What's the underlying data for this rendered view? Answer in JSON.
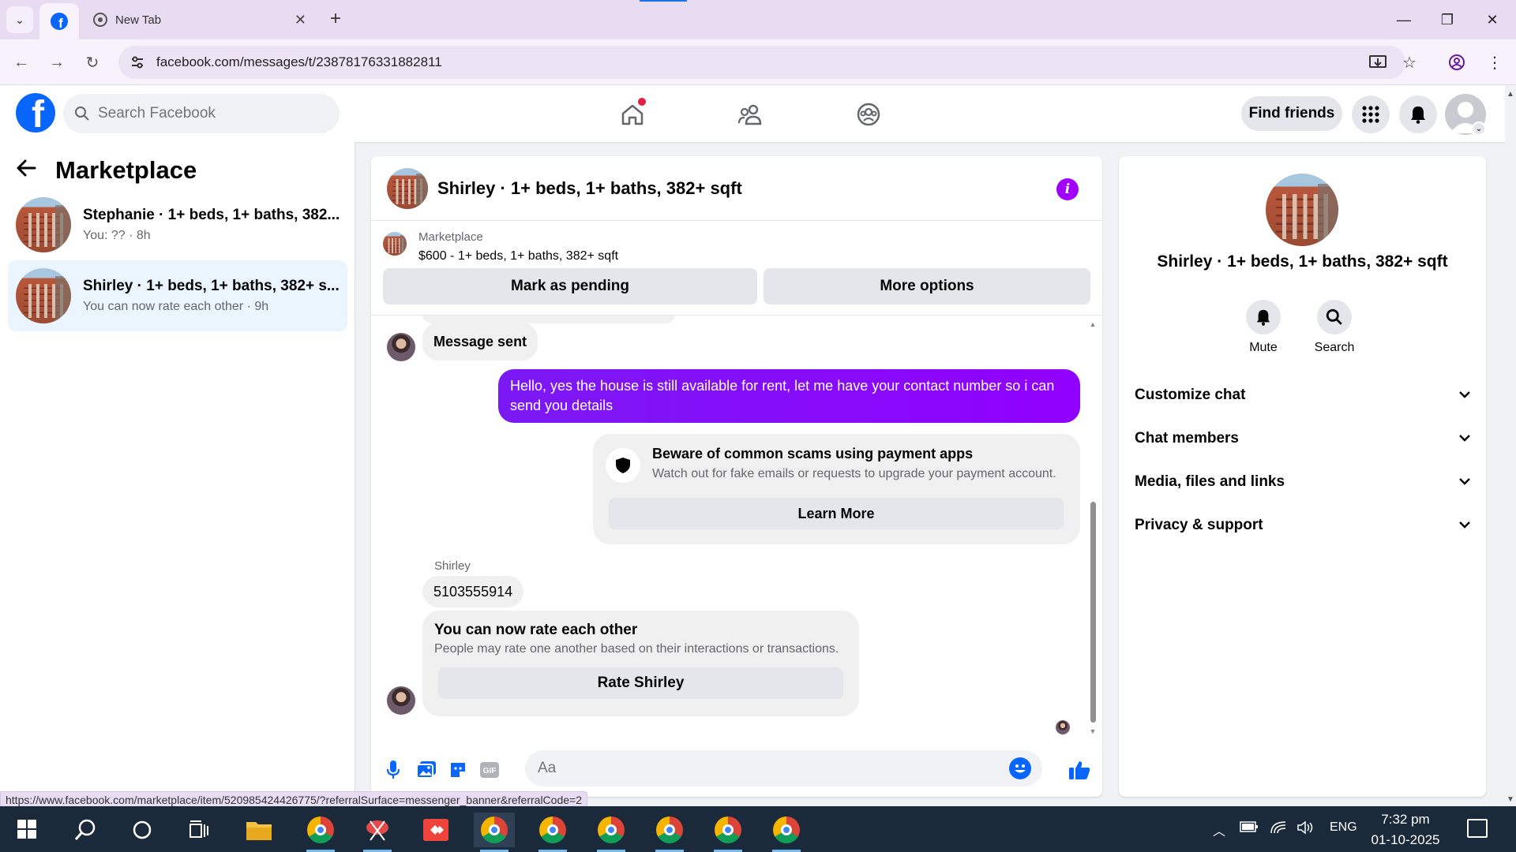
{
  "browser": {
    "tab_title": "New Tab",
    "url": "facebook.com/messages/t/23878176331882811",
    "status_url": "https://www.facebook.com/marketplace/item/520985424426775/?referralSurface=messenger_banner&referralCode=2"
  },
  "header": {
    "search_placeholder": "Search Facebook",
    "find_friends": "Find friends"
  },
  "sidebar": {
    "title": "Marketplace",
    "conversations": [
      {
        "name": "Stephanie · 1+ beds, 1+ baths, 382...",
        "sub": "You: ?? · 8h"
      },
      {
        "name": "Shirley · 1+ beds, 1+ baths, 382+ s...",
        "sub": "You can now rate each other · 9h"
      }
    ]
  },
  "chat": {
    "title": "Shirley · 1+ beds, 1+ baths, 382+ sqft",
    "banner": {
      "label": "Marketplace",
      "price": "$600 - 1+ beds, 1+ baths, 382+ sqft",
      "mark_pending": "Mark as pending",
      "more_options": "More options"
    },
    "messages": {
      "sent_notice": "Message sent",
      "outgoing": "Hello, yes the house is still available for rent, let me have your contact number so i can send you  details",
      "scam_title": "Beware of common scams using payment apps",
      "scam_sub": "Watch out for fake emails or requests to upgrade your payment account.",
      "learn_more": "Learn More",
      "sender": "Shirley",
      "phone": "5103555914",
      "rate_title": "You can now rate each other",
      "rate_sub": "People may rate one another based on their interactions or transactions.",
      "rate_button": "Rate Shirley"
    },
    "composer_placeholder": "Aa"
  },
  "info_panel": {
    "name": "Shirley · 1+ beds, 1+ baths, 382+ sqft",
    "actions": [
      "Mute",
      "Search"
    ],
    "sections": [
      "Customize chat",
      "Chat members",
      "Media, files and links",
      "Privacy & support"
    ]
  },
  "taskbar": {
    "lang": "ENG",
    "time": "7:32 pm",
    "date": "01-10-2025"
  },
  "colors": {
    "accent": "#0866ff",
    "outgoing_bubble": "#8a00ff",
    "selected_conv": "#ebf5ff"
  }
}
